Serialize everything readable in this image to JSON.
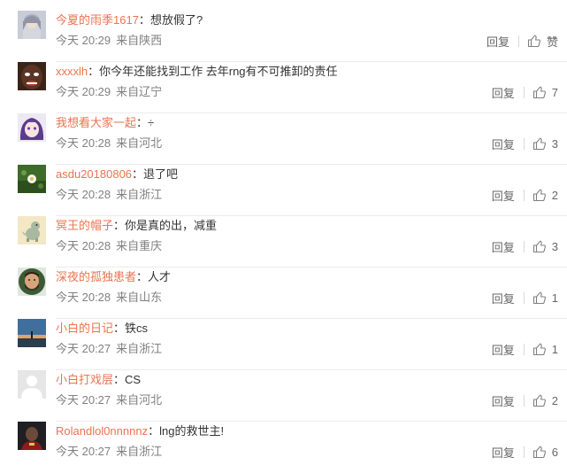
{
  "comments": [
    {
      "user": "今夏的雨季1617",
      "text": "想放假了?",
      "time": "今天 20:29",
      "source": "来自陕西",
      "reply_label": "回复",
      "like_label": "赞",
      "avatar": "grey-hair-anime-avatar"
    },
    {
      "user": "xxxxlh",
      "text": "你今年还能找到工作 去年rng有不可推卸的责任",
      "time": "今天 20:29",
      "source": "来自辽宁",
      "reply_label": "回复",
      "like_label": "7",
      "avatar": "face-photo-avatar"
    },
    {
      "user": "我想看大家一起",
      "text": "÷",
      "time": "今天 20:28",
      "source": "来自河北",
      "reply_label": "回复",
      "like_label": "3",
      "avatar": "purple-anime-avatar"
    },
    {
      "user": "asdu20180806",
      "text": "退了吧",
      "time": "今天 20:28",
      "source": "来自浙江",
      "reply_label": "回复",
      "like_label": "2",
      "avatar": "flower-photo-avatar"
    },
    {
      "user": "冥王的帽子",
      "text": "你是真的出，减重",
      "time": "今天 20:28",
      "source": "来自重庆",
      "reply_label": "回复",
      "like_label": "3",
      "avatar": "cartoon-dinosaur-avatar"
    },
    {
      "user": "深夜的孤独患者",
      "text": "人才",
      "time": "今天 20:28",
      "source": "来自山东",
      "reply_label": "回复",
      "like_label": "1",
      "avatar": "bearded-man-avatar"
    },
    {
      "user": "小白的日记",
      "text": "铁cs",
      "time": "今天 20:27",
      "source": "来自浙江",
      "reply_label": "回复",
      "like_label": "1",
      "avatar": "sky-horizon-avatar"
    },
    {
      "user": "小白打戏层",
      "text": "CS",
      "time": "今天 20:27",
      "source": "来自河北",
      "reply_label": "回复",
      "like_label": "2",
      "avatar": "default-user-avatar"
    },
    {
      "user": "Rolandlol0nnnnnz",
      "text": "lng的救世主!",
      "time": "今天 20:27",
      "source": "来自浙江",
      "reply_label": "回复",
      "like_label": "6",
      "avatar": "dark-photo-avatar"
    }
  ],
  "colors": {
    "username": "#eb7350",
    "body_text": "#333333",
    "meta_text": "#808080",
    "divider": "#ececec"
  },
  "icons": {
    "like": "thumbs-up-icon"
  }
}
